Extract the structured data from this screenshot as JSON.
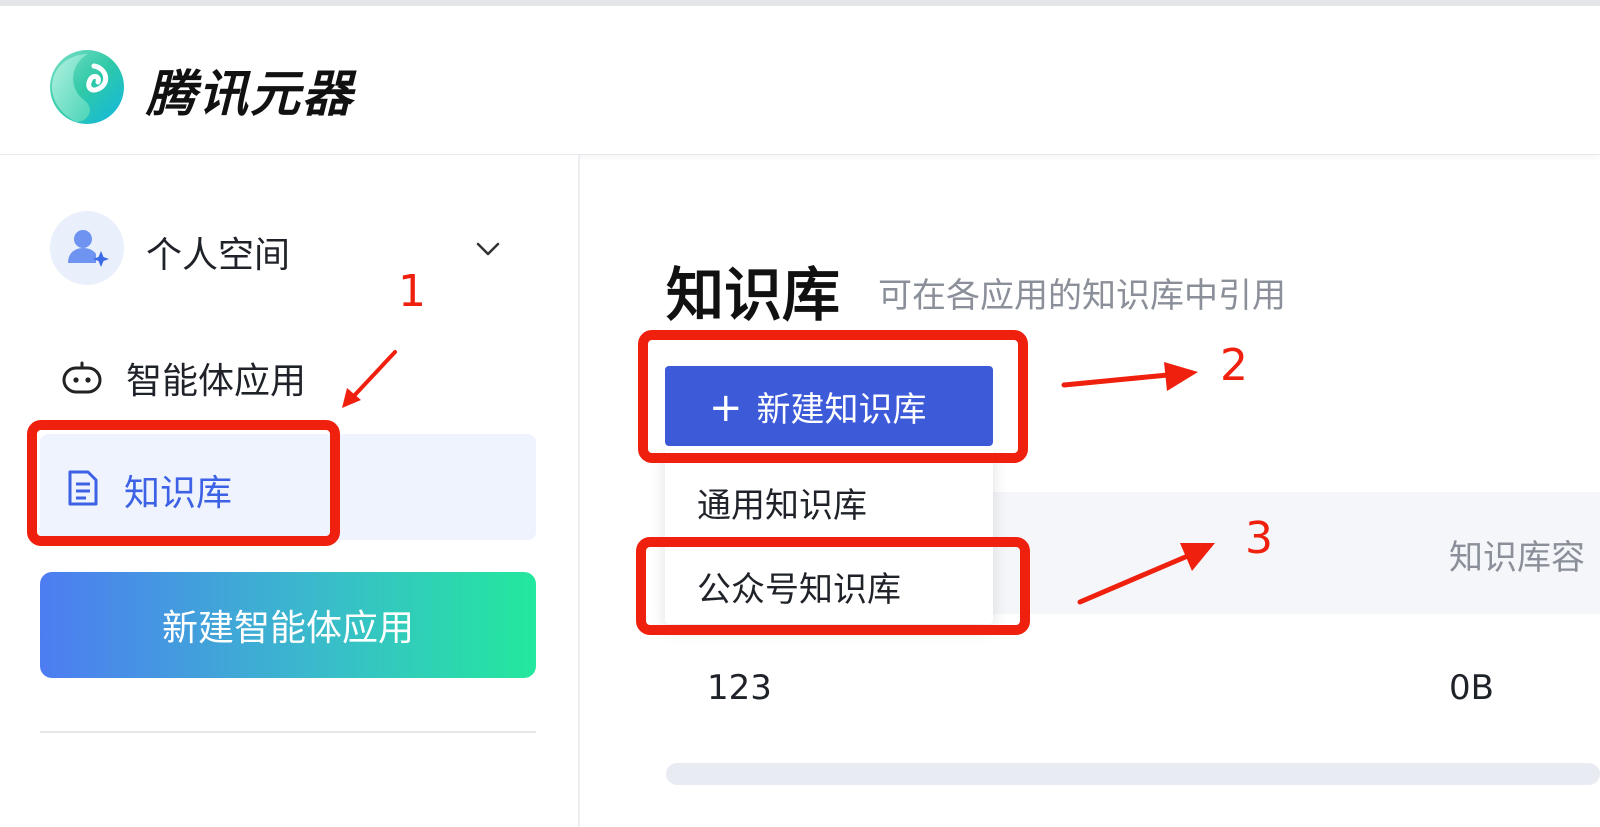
{
  "app": {
    "brand": "腾讯元器"
  },
  "sidebar": {
    "workspace": {
      "label": "个人空间"
    },
    "nav": [
      {
        "label": "智能体应用",
        "icon": "robot-icon"
      },
      {
        "label": "知识库",
        "icon": "document-icon",
        "active": true
      }
    ],
    "new_agent_button": "新建智能体应用"
  },
  "main": {
    "title": "知识库",
    "subtitle": "可在各应用的知识库中引用",
    "create_button": {
      "icon": "plus-icon",
      "label": "新建知识库"
    },
    "dropdown": {
      "items": [
        "通用知识库",
        "公众号知识库"
      ]
    },
    "table": {
      "columns": [
        "知识库容"
      ],
      "rows": [
        {
          "name": "123",
          "size": "0B"
        }
      ]
    }
  },
  "annotations": {
    "numbers": [
      "1",
      "2",
      "3"
    ],
    "color": "#f0200e"
  },
  "colors": {
    "accent": "#3d5bd9",
    "active_text": "#3d62e6",
    "active_bg": "#eef3fd"
  }
}
